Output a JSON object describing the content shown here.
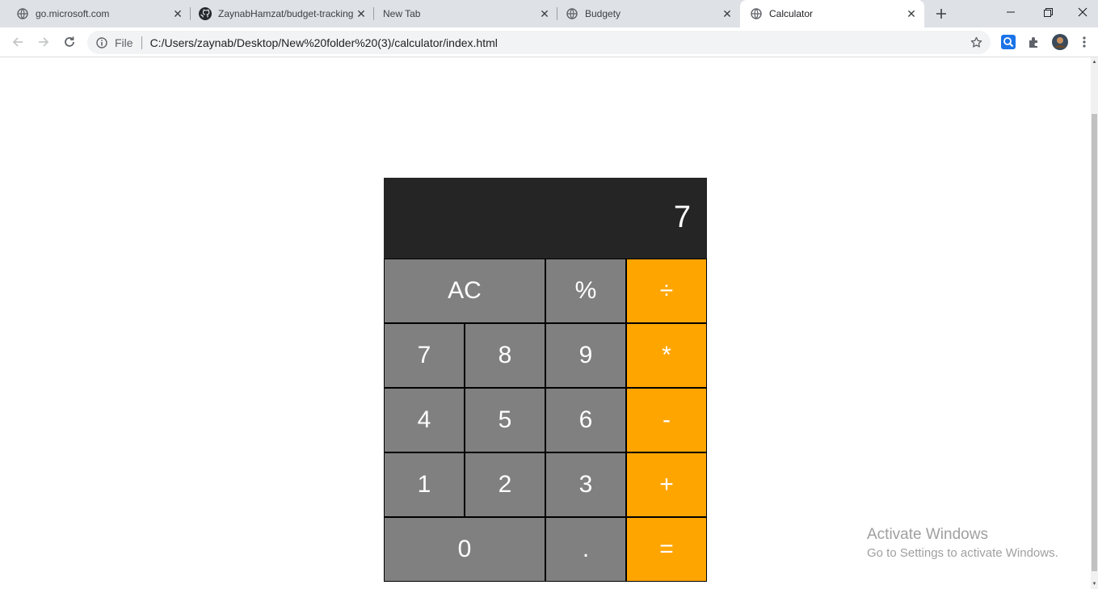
{
  "browser": {
    "tabs": [
      {
        "title": "go.microsoft.com",
        "favicon": "globe-icon",
        "active": false
      },
      {
        "title": "ZaynabHamzat/budget-tracking",
        "favicon": "github-icon",
        "active": false
      },
      {
        "title": "New Tab",
        "favicon": "",
        "active": false
      },
      {
        "title": "Budgety",
        "favicon": "globe-icon",
        "active": false
      },
      {
        "title": "Calculator",
        "favicon": "globe-icon",
        "active": true
      }
    ],
    "address": {
      "scheme_label": "File",
      "url": "C:/Users/zaynab/Desktop/New%20folder%20(3)/calculator/index.html"
    }
  },
  "calculator": {
    "display": "7",
    "keys": {
      "clear": "AC",
      "percent": "%",
      "divide": "÷",
      "seven": "7",
      "eight": "8",
      "nine": "9",
      "multiply": "*",
      "four": "4",
      "five": "5",
      "six": "6",
      "subtract": "-",
      "one": "1",
      "two": "2",
      "three": "3",
      "add": "+",
      "zero": "0",
      "decimal": ".",
      "equals": "="
    },
    "colors": {
      "display_bg": "#252525",
      "key_bg": "#808080",
      "operator_bg": "#ffa500",
      "text": "#ffffff"
    }
  },
  "watermark": {
    "line1": "Activate Windows",
    "line2": "Go to Settings to activate Windows."
  }
}
